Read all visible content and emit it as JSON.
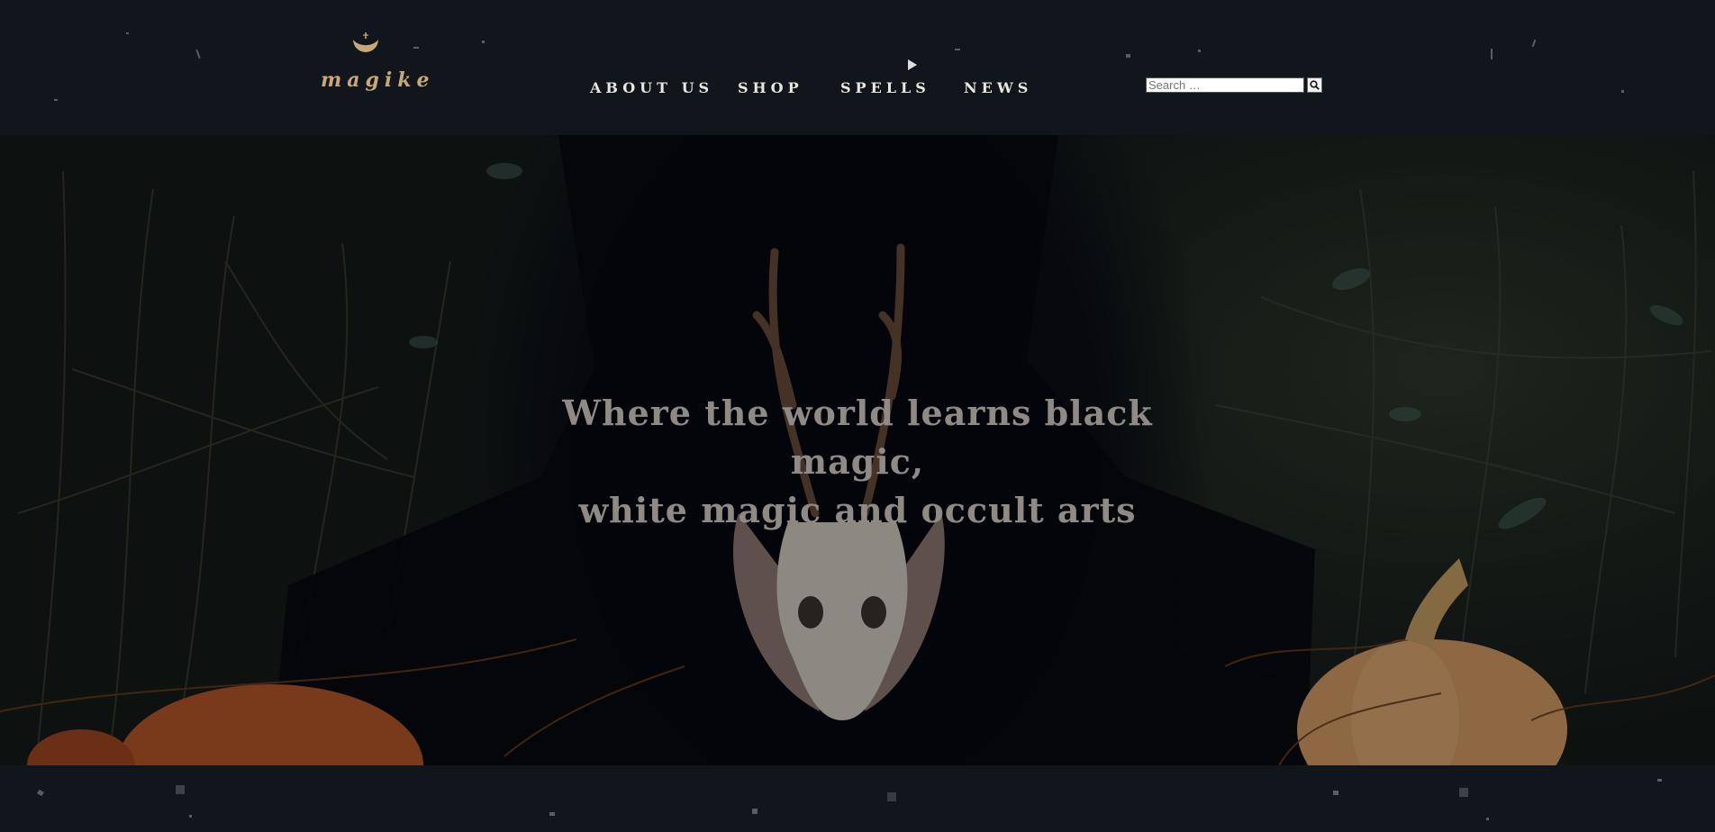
{
  "header": {
    "logo": {
      "text": "magike",
      "icon": "crescent-moon-icon",
      "color": "#c9a878"
    },
    "nav": {
      "items": [
        {
          "label": "ABOUT US"
        },
        {
          "label": "SHOP"
        },
        {
          "label": "SPELLS"
        },
        {
          "label": "NEWS"
        }
      ]
    },
    "search": {
      "placeholder": "Search …",
      "value": "",
      "button_icon": "search-icon"
    }
  },
  "hero": {
    "title_line1": "Where the world learns black magic,",
    "title_line2": "white magic and occult arts",
    "title_color": "#8f8a86"
  },
  "theme": {
    "background": "#11161c",
    "nav_text": "#e9e6dd"
  }
}
